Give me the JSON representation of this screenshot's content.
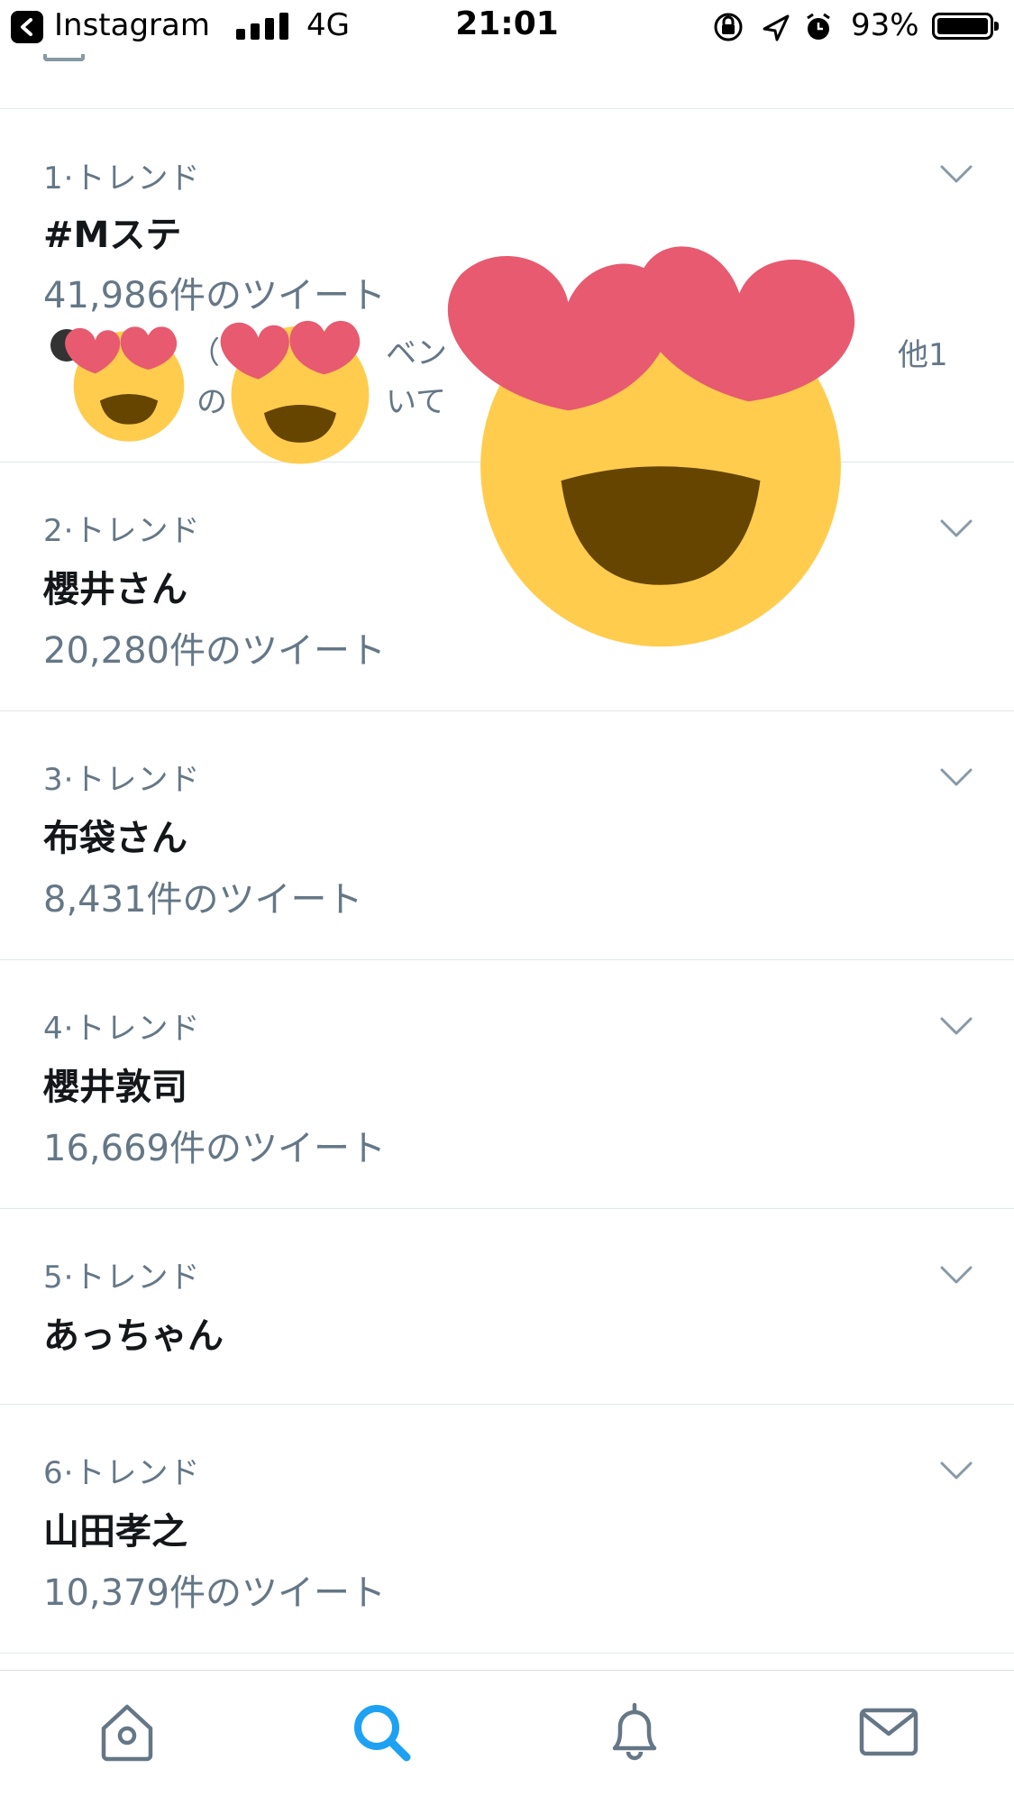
{
  "status_bar": {
    "back_app": "Instagram",
    "network": "4G",
    "time": "21:01",
    "battery": "93%"
  },
  "trends": [
    {
      "rank": "1·トレンド",
      "name": "#Mステ",
      "count": "41,986件のツイート",
      "related_line1": "（",
      "related_line1b": "ベン",
      "related_more": "他1",
      "related_line2": "の",
      "related_line2b": "いて"
    },
    {
      "rank": "2·トレンド",
      "name": "櫻井さん",
      "count": "20,280件のツイート"
    },
    {
      "rank": "3·トレンド",
      "name": "布袋さん",
      "count": "8,431件のツイート"
    },
    {
      "rank": "4·トレンド",
      "name": "櫻井敦司",
      "count": "16,669件のツイート"
    },
    {
      "rank": "5·トレンド",
      "name": "あっちゃん"
    },
    {
      "rank": "6·トレンド",
      "name": "山田孝之",
      "count": "10,379件のツイート"
    }
  ],
  "tabbar": {
    "items": [
      "home-icon",
      "search-icon",
      "notifications-icon",
      "messages-icon"
    ],
    "active": "search-icon",
    "accent": "#1da1f2"
  },
  "colors": {
    "secondary_text": "#657786",
    "divider": "#e1e8ed",
    "emoji_face": "#ffcc4d",
    "emoji_heart": "#e75a70",
    "emoji_mouth": "#664500"
  }
}
